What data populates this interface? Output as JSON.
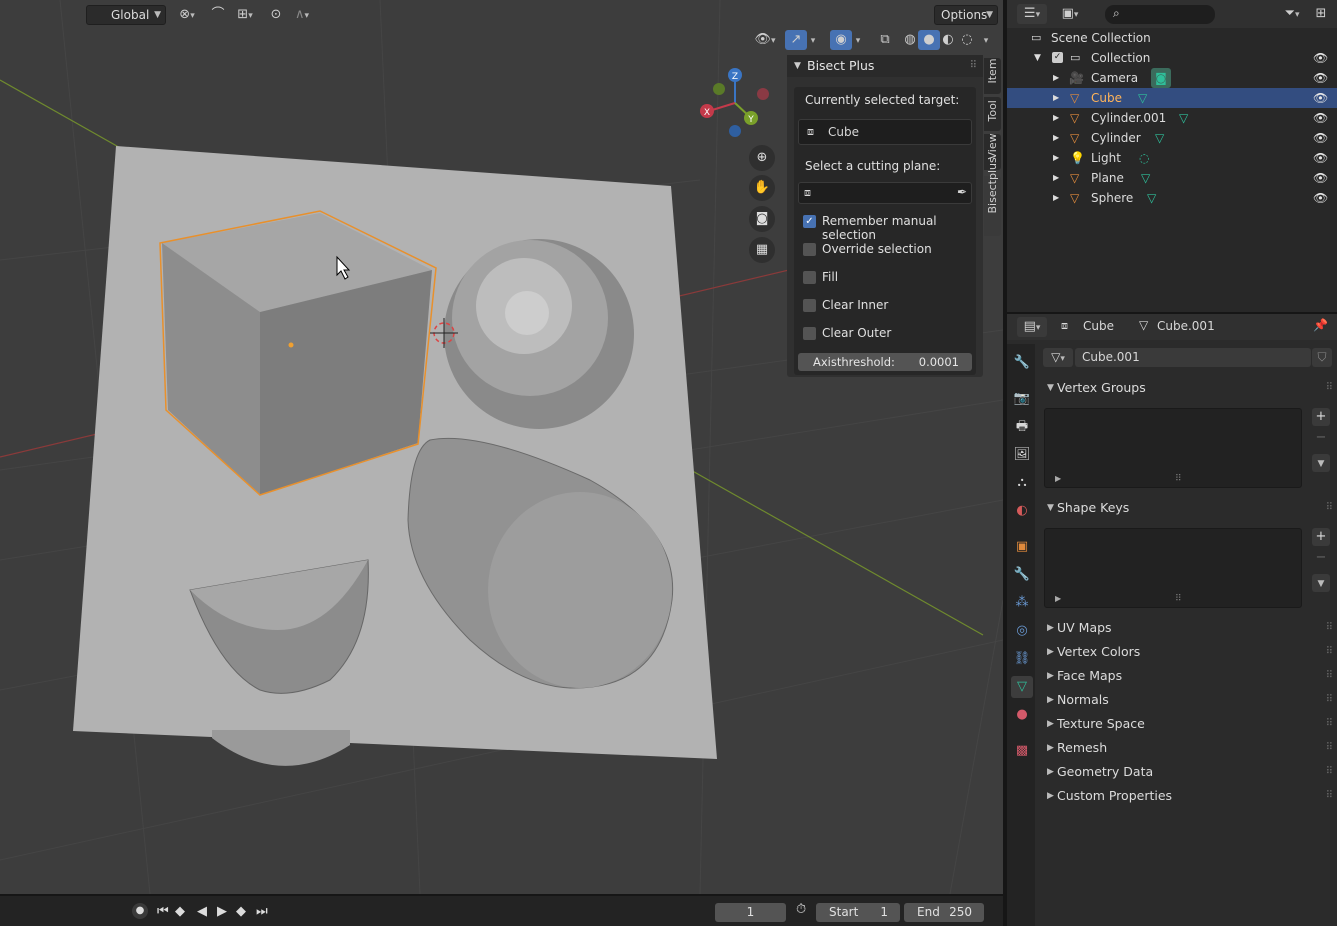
{
  "viewport_header": {
    "orientation": "Global",
    "options_label": "Options"
  },
  "gizmo": {
    "x": "X",
    "y": "Y",
    "z": "Z"
  },
  "npanel": {
    "title": "Bisect Plus",
    "target_label": "Currently selected target:",
    "target_value": "Cube",
    "plane_label": "Select a cutting plane:",
    "plane_value": "",
    "checkboxes": [
      {
        "label": "Remember manual selection",
        "checked": true
      },
      {
        "label": "Override selection",
        "checked": false
      },
      {
        "label": "Fill",
        "checked": false
      },
      {
        "label": "Clear Inner",
        "checked": false
      },
      {
        "label": "Clear Outer",
        "checked": false
      }
    ],
    "axis_label": "Axisthreshold:",
    "axis_value": "0.0001"
  },
  "side_tabs": [
    "Item",
    "Tool",
    "View",
    "Bisectplus"
  ],
  "timeline": {
    "current_frame": "1",
    "start_label": "Start",
    "start_value": "1",
    "end_label": "End",
    "end_value": "250"
  },
  "outliner": {
    "search_placeholder": "",
    "scene_collection": "Scene Collection",
    "collection": "Collection",
    "items": [
      {
        "name": "Camera"
      },
      {
        "name": "Cube"
      },
      {
        "name": "Cylinder.001"
      },
      {
        "name": "Cylinder"
      },
      {
        "name": "Light"
      },
      {
        "name": "Plane"
      },
      {
        "name": "Sphere"
      }
    ]
  },
  "properties": {
    "object_name": "Cube",
    "mesh_name": "Cube.001",
    "datablock": "Cube.001",
    "sections_open": [
      "Vertex Groups",
      "Shape Keys"
    ],
    "sections_closed": [
      "UV Maps",
      "Vertex Colors",
      "Face Maps",
      "Normals",
      "Texture Space",
      "Remesh",
      "Geometry Data",
      "Custom Properties"
    ]
  }
}
